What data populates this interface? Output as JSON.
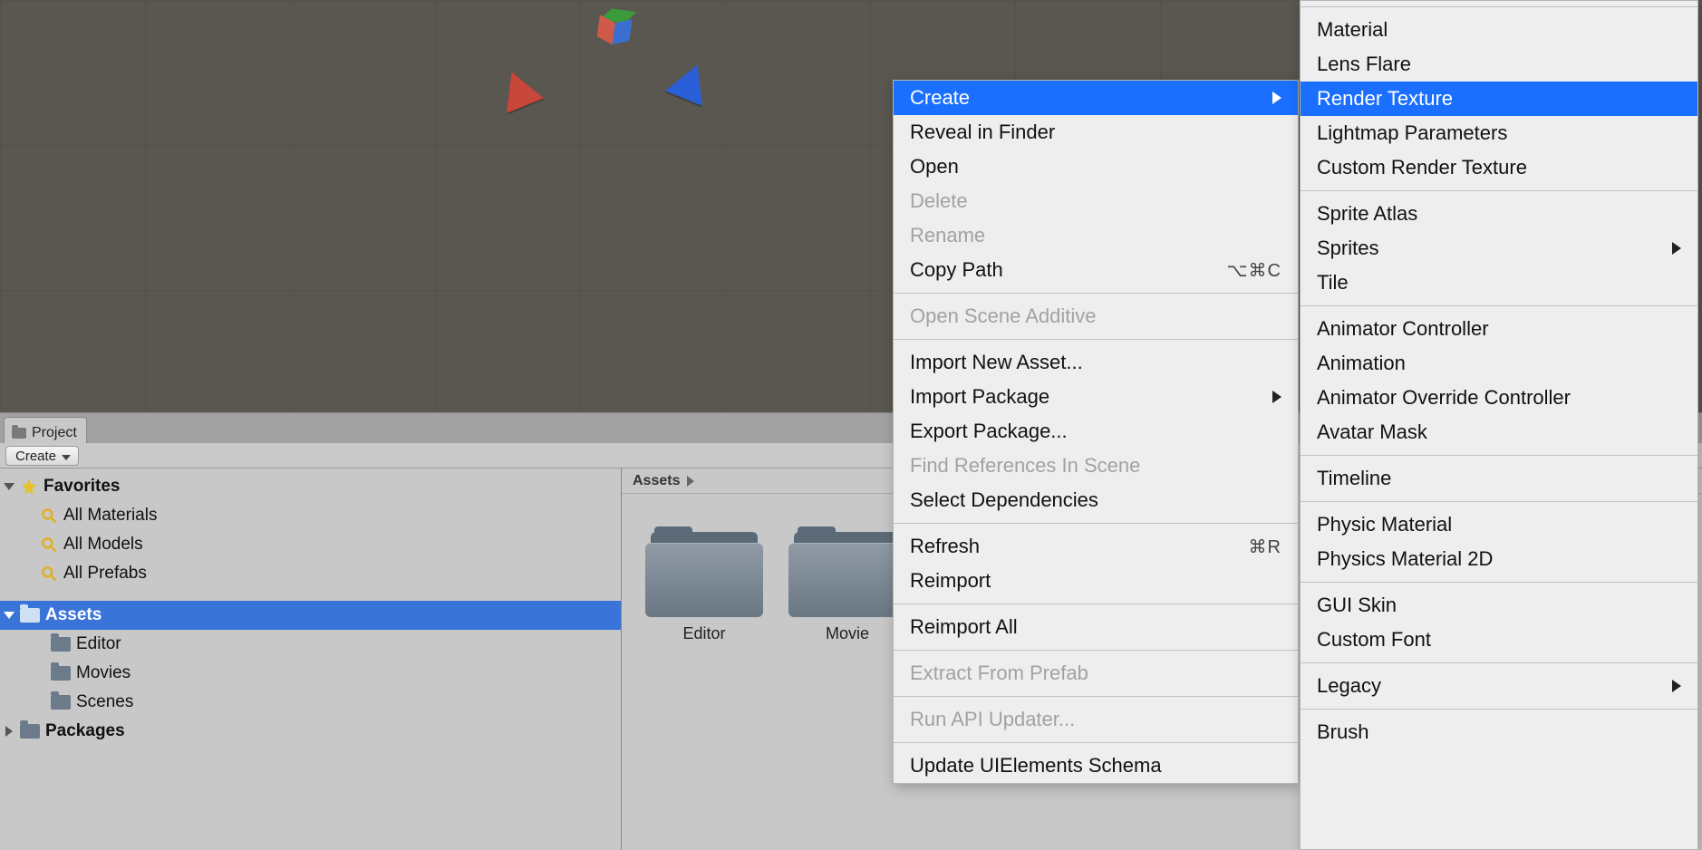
{
  "project": {
    "tab": "Project",
    "create_btn": "Create",
    "favorites": {
      "label": "Favorites",
      "items": [
        {
          "label": "All Materials"
        },
        {
          "label": "All Models"
        },
        {
          "label": "All Prefabs"
        }
      ]
    },
    "assets_node": "Assets",
    "asset_children": [
      {
        "label": "Editor"
      },
      {
        "label": "Movies"
      },
      {
        "label": "Scenes"
      }
    ],
    "packages_node": "Packages"
  },
  "breadcrumb": {
    "root": "Assets"
  },
  "grid_items": [
    {
      "label": "Editor"
    },
    {
      "label": "Movie"
    }
  ],
  "context_menu": {
    "items": [
      {
        "label": "Create",
        "highlight": true,
        "submenu": true
      },
      {
        "label": "Reveal in Finder"
      },
      {
        "label": "Open"
      },
      {
        "label": "Delete",
        "disabled": true
      },
      {
        "label": "Rename",
        "disabled": true
      },
      {
        "label": "Copy Path",
        "shortcut": "⌥⌘C"
      },
      {
        "sep": true
      },
      {
        "label": "Open Scene Additive",
        "disabled": true
      },
      {
        "sep": true
      },
      {
        "label": "Import New Asset..."
      },
      {
        "label": "Import Package",
        "submenu": true
      },
      {
        "label": "Export Package..."
      },
      {
        "label": "Find References In Scene",
        "disabled": true
      },
      {
        "label": "Select Dependencies"
      },
      {
        "sep": true
      },
      {
        "label": "Refresh",
        "shortcut": "⌘R"
      },
      {
        "label": "Reimport"
      },
      {
        "sep": true
      },
      {
        "label": "Reimport All"
      },
      {
        "sep": true
      },
      {
        "label": "Extract From Prefab",
        "disabled": true
      },
      {
        "sep": true
      },
      {
        "label": "Run API Updater...",
        "disabled": true
      },
      {
        "sep": true
      },
      {
        "label": "Update UIElements Schema"
      }
    ]
  },
  "create_submenu": {
    "items": [
      {
        "sep": true
      },
      {
        "label": "Material"
      },
      {
        "label": "Lens Flare"
      },
      {
        "label": "Render Texture",
        "highlight": true
      },
      {
        "label": "Lightmap Parameters"
      },
      {
        "label": "Custom Render Texture"
      },
      {
        "sep": true
      },
      {
        "label": "Sprite Atlas"
      },
      {
        "label": "Sprites",
        "submenu": true
      },
      {
        "label": "Tile"
      },
      {
        "sep": true
      },
      {
        "label": "Animator Controller"
      },
      {
        "label": "Animation"
      },
      {
        "label": "Animator Override Controller"
      },
      {
        "label": "Avatar Mask"
      },
      {
        "sep": true
      },
      {
        "label": "Timeline"
      },
      {
        "sep": true
      },
      {
        "label": "Physic Material"
      },
      {
        "label": "Physics Material 2D"
      },
      {
        "sep": true
      },
      {
        "label": "GUI Skin"
      },
      {
        "label": "Custom Font"
      },
      {
        "sep": true
      },
      {
        "label": "Legacy",
        "submenu": true
      },
      {
        "sep": true
      },
      {
        "label": "Brush"
      }
    ]
  }
}
